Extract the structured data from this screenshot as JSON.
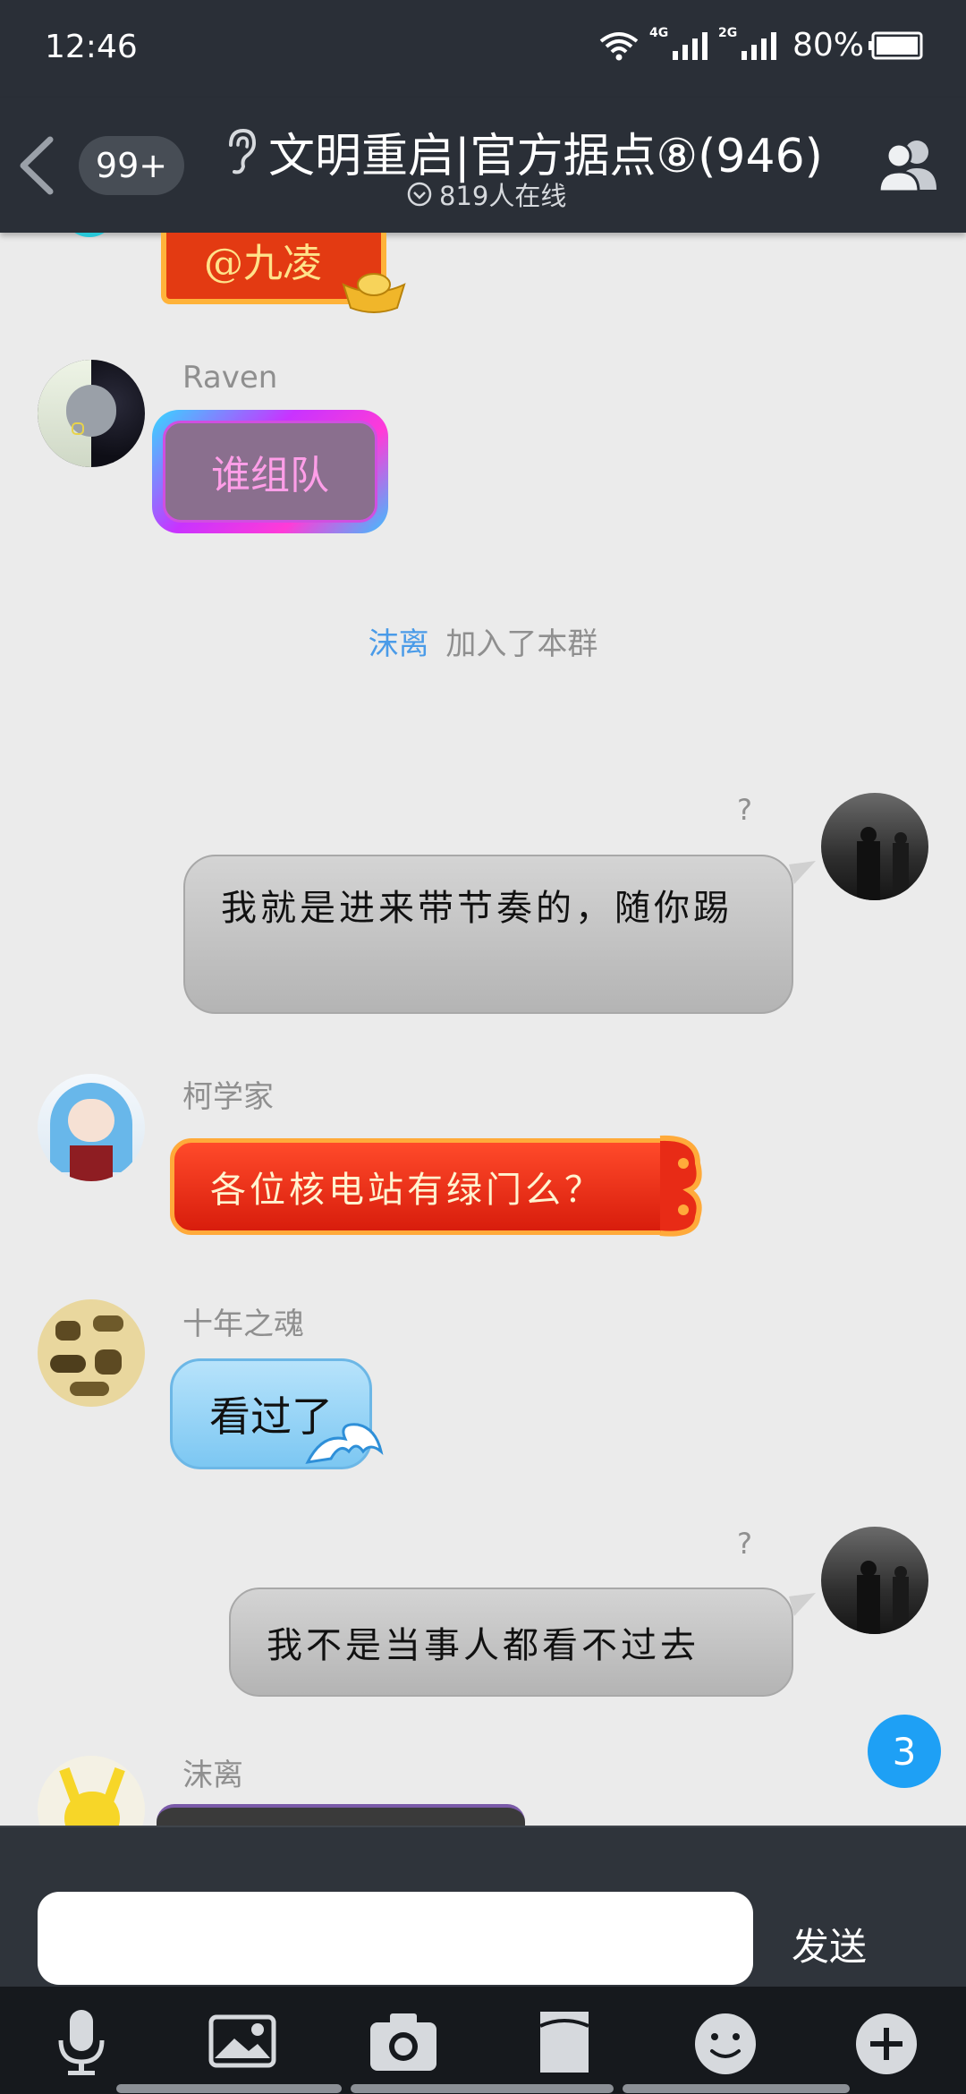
{
  "status_bar": {
    "time": "12:46",
    "signal_4g": "4G",
    "signal_2g": "2G",
    "battery": "80%"
  },
  "header": {
    "unread_count": "99+",
    "title": "文明重启|官方据点⑧(946)",
    "online": "819人在线"
  },
  "messages": [
    {
      "type": "bubble_partial",
      "text": "@九凌"
    },
    {
      "type": "incoming",
      "sender": "Raven",
      "text": "谁组队"
    },
    {
      "type": "system",
      "name": "沫离",
      "text": "加入了本群"
    },
    {
      "type": "outgoing",
      "mark": "?",
      "text": "我就是进来带节奏的，随你踢"
    },
    {
      "type": "incoming",
      "sender": "柯学家",
      "text": "各位核电站有绿门么？"
    },
    {
      "type": "incoming",
      "sender": "十年之魂",
      "text": "看过了"
    },
    {
      "type": "outgoing",
      "mark": "?",
      "text": "我不是当事人都看不过去"
    },
    {
      "type": "incoming",
      "sender": "沫离"
    }
  ],
  "new_message_badge": "3",
  "input": {
    "value": "",
    "send_label": "发送"
  },
  "toolbar": [
    "microphone-icon",
    "image-icon",
    "camera-icon",
    "file-icon",
    "emoji-icon",
    "plus-icon"
  ],
  "colors": {
    "bar": "#2a2f37",
    "chat_bg": "#ebebeb",
    "accent": "#1ea0f5",
    "red_bubble": "#e82b16"
  }
}
